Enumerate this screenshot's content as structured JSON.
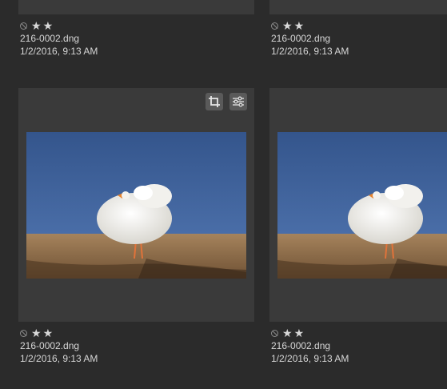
{
  "grid": {
    "items": [
      {
        "rating_stars": 2,
        "rejected_icon": "reject-icon",
        "filename": "216-0002.dng",
        "datetime": "1/2/2016, 9:13 AM"
      },
      {
        "rating_stars": 2,
        "rejected_icon": "reject-icon",
        "filename": "216-0002.dng",
        "datetime": "1/2/2016, 9:13 AM"
      },
      {
        "rating_stars": 2,
        "rejected_icon": "reject-icon",
        "filename": "216-0002.dng",
        "datetime": "1/2/2016, 9:13 AM",
        "badges": [
          "crop-icon",
          "adjustments-icon"
        ]
      },
      {
        "rating_stars": 2,
        "rejected_icon": "reject-icon",
        "filename": "216-0002.dng",
        "datetime": "1/2/2016, 9:13 AM"
      }
    ]
  },
  "colors": {
    "background": "#2b2b2b",
    "card": "#3a3a3a",
    "sky": "#3e5f93",
    "sand": "#9b7650"
  }
}
